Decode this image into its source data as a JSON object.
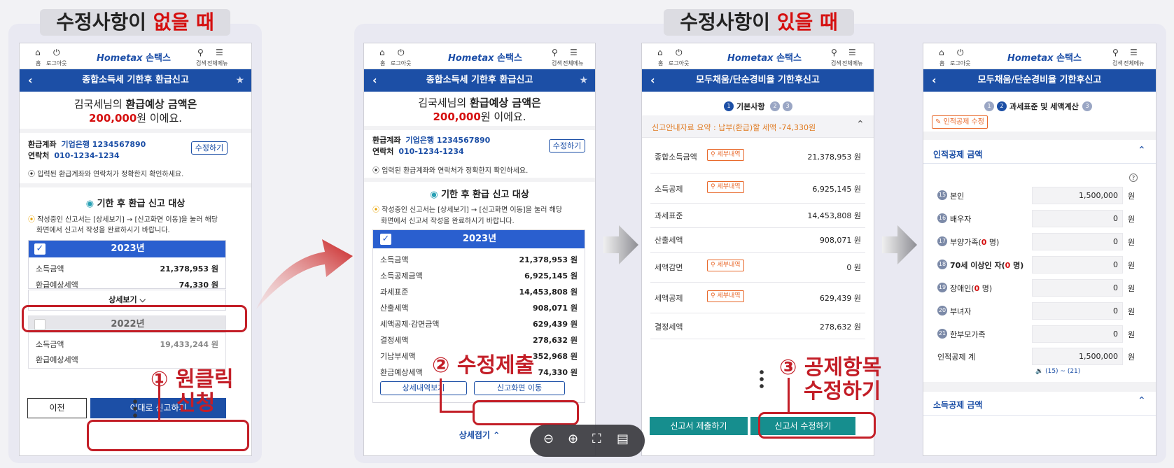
{
  "headings": {
    "left_pre": "수정사항이",
    "left_hl": "없을 때",
    "right_pre": "수정사항이",
    "right_hl": "있을 때"
  },
  "appbar": {
    "home": "홈",
    "logout": "로그아웃",
    "search": "검색",
    "menu": "전체메뉴",
    "logo_brand": "Hometax",
    "logo_kr": "손택스"
  },
  "screen1": {
    "title": "종합소득세 기한후 환급신고",
    "headline_a": "김국세님의 ",
    "headline_b": "환급예상 금액은",
    "amount": "200,000",
    "amount_suffix": "원 이에요.",
    "account_label": "환급계좌",
    "account_value": "기업은행 1234567890",
    "contact_label": "연락처",
    "contact_value": "010-1234-1234",
    "edit_button": "수정하기",
    "notice": "입력된 환급계좌와 연락처가 정확한지 확인하세요.",
    "section_title": "기한 후 환급 신고 대상",
    "guide_1": "작성중인 신고서는 [상세보기] → [신고화면 이동]을 눌러 해당",
    "guide_2": "화면에서 신고서 작성을 완료하시기 바랍니다.",
    "card1_year": "2023년",
    "card1_rows": [
      {
        "label": "소득금액",
        "value": "21,378,953 원"
      },
      {
        "label": "환급예상세액",
        "value": "74,330 원"
      }
    ],
    "detail_button": "상세보기 ⌵",
    "card2_year": "2022년",
    "card2_rows": [
      {
        "label": "소득금액",
        "value": "19,433,244 원"
      },
      {
        "label": "환급예상세액",
        "value": ""
      }
    ],
    "prev_button": "이전",
    "submit_button": "이대로 신고하기"
  },
  "screen2": {
    "title": "종합소득세 기한후 환급신고",
    "headline_a": "김국세님의 ",
    "headline_b": "환급예상 금액은",
    "amount": "200,000",
    "amount_suffix": "원 이에요.",
    "account_label": "환급계좌",
    "account_value": "기업은행 1234567890",
    "contact_label": "연락처",
    "contact_value": "010-1234-1234",
    "edit_button": "수정하기",
    "notice": "입력된 환급계좌와 연락처가 정확한지 확인하세요.",
    "section_title": "기한 후 환급 신고 대상",
    "guide_1": "작성중인 신고서는 [상세보기] → [신고화면 이동]을 눌러 해당",
    "guide_2": "화면에서 신고서 작성을 완료하시기 바랍니다.",
    "card_year": "2023년",
    "rows": [
      {
        "label": "소득금액",
        "value": "21,378,953 원"
      },
      {
        "label": "소득공제금액",
        "value": "6,925,145 원"
      },
      {
        "label": "과세표준",
        "value": "14,453,808 원"
      },
      {
        "label": "산출세액",
        "value": "908,071 원"
      },
      {
        "label": "세액공제·감면금액",
        "value": "629,439 원"
      },
      {
        "label": "결정세액",
        "value": "278,632 원"
      },
      {
        "label": "기납부세액",
        "value": "352,968 원"
      },
      {
        "label": "환급예상세액",
        "value": "74,330 원"
      }
    ],
    "detail_list_button": "상세내역보기",
    "move_button": "신고화면 이동",
    "collapse_button": "상세접기 ⌃"
  },
  "screen3": {
    "title": "모두채움/단순경비율 기한후신고",
    "step_label": "기본사항",
    "summary": "신고안내자료 요약 : 납부(환급)할 세액 -74,330원",
    "tag_label": "세부내역",
    "rows": [
      {
        "label": "종합소득금액",
        "value": "21,378,953  원",
        "tag": true
      },
      {
        "label": "소득공제",
        "value": "6,925,145  원",
        "tag": true
      },
      {
        "label": "과세표준",
        "value": "14,453,808  원",
        "tag": false
      },
      {
        "label": "산출세액",
        "value": "908,071  원",
        "tag": false
      },
      {
        "label": "세액감면",
        "value": "0  원",
        "tag": true
      },
      {
        "label": "세액공제",
        "value": "629,439  원",
        "tag": true
      },
      {
        "label": "결정세액",
        "value": "278,632  원",
        "tag": false
      }
    ],
    "submit_button": "신고서 제출하기",
    "modify_button": "신고서 수정하기"
  },
  "screen4": {
    "title": "모두채움/단순경비율 기한후신고",
    "step_label": "과세표준 및 세액계산",
    "edit_tag": "인적공제 수정",
    "section1": "인적공제 금액",
    "rows": [
      {
        "num": "15",
        "label": "본인",
        "extra": "",
        "value": "1,500,000"
      },
      {
        "num": "16",
        "label": "배우자",
        "extra": "",
        "value": "0"
      },
      {
        "num": "17",
        "label": "부양가족(",
        "extra": "0",
        "suffix": " 명)",
        "value": "0"
      },
      {
        "num": "18",
        "label": "70세 이상인 자(",
        "extra": "0",
        "suffix": " 명)",
        "value": "0"
      },
      {
        "num": "19",
        "label": "장애인(",
        "extra": "0",
        "suffix": " 명)",
        "value": "0"
      },
      {
        "num": "20",
        "label": "부녀자",
        "extra": "",
        "value": "0"
      },
      {
        "num": "21",
        "label": "한부모가족",
        "extra": "",
        "value": "0"
      }
    ],
    "total_label": "인적공제 계",
    "total_value": "1,500,000",
    "unit": "원",
    "range_note": "(15) ~ (21)",
    "section2": "소득공제 금액"
  },
  "callouts": {
    "c1_num": "①",
    "c1_line1": "원클릭",
    "c1_line2": "신청",
    "c2_num": "②",
    "c2_text": "수정제출",
    "c3_num": "③",
    "c3_line1": "공제항목",
    "c3_line2": "수정하기"
  },
  "icons": [
    "home-icon",
    "power-icon",
    "search-icon",
    "menu-icon",
    "back-icon",
    "star-icon",
    "check-icon",
    "chevron-up-icon",
    "zoom-out-icon",
    "zoom-in-icon",
    "fullscreen-icon",
    "notes-icon",
    "help-icon",
    "pencil-icon",
    "magnifier-icon"
  ],
  "colors": {
    "accent_blue": "#1c4fa6",
    "highlight_red": "#d50f0f",
    "callout_red": "#c31e27",
    "teal": "#168e8e",
    "orange_tag": "#e8682a"
  }
}
